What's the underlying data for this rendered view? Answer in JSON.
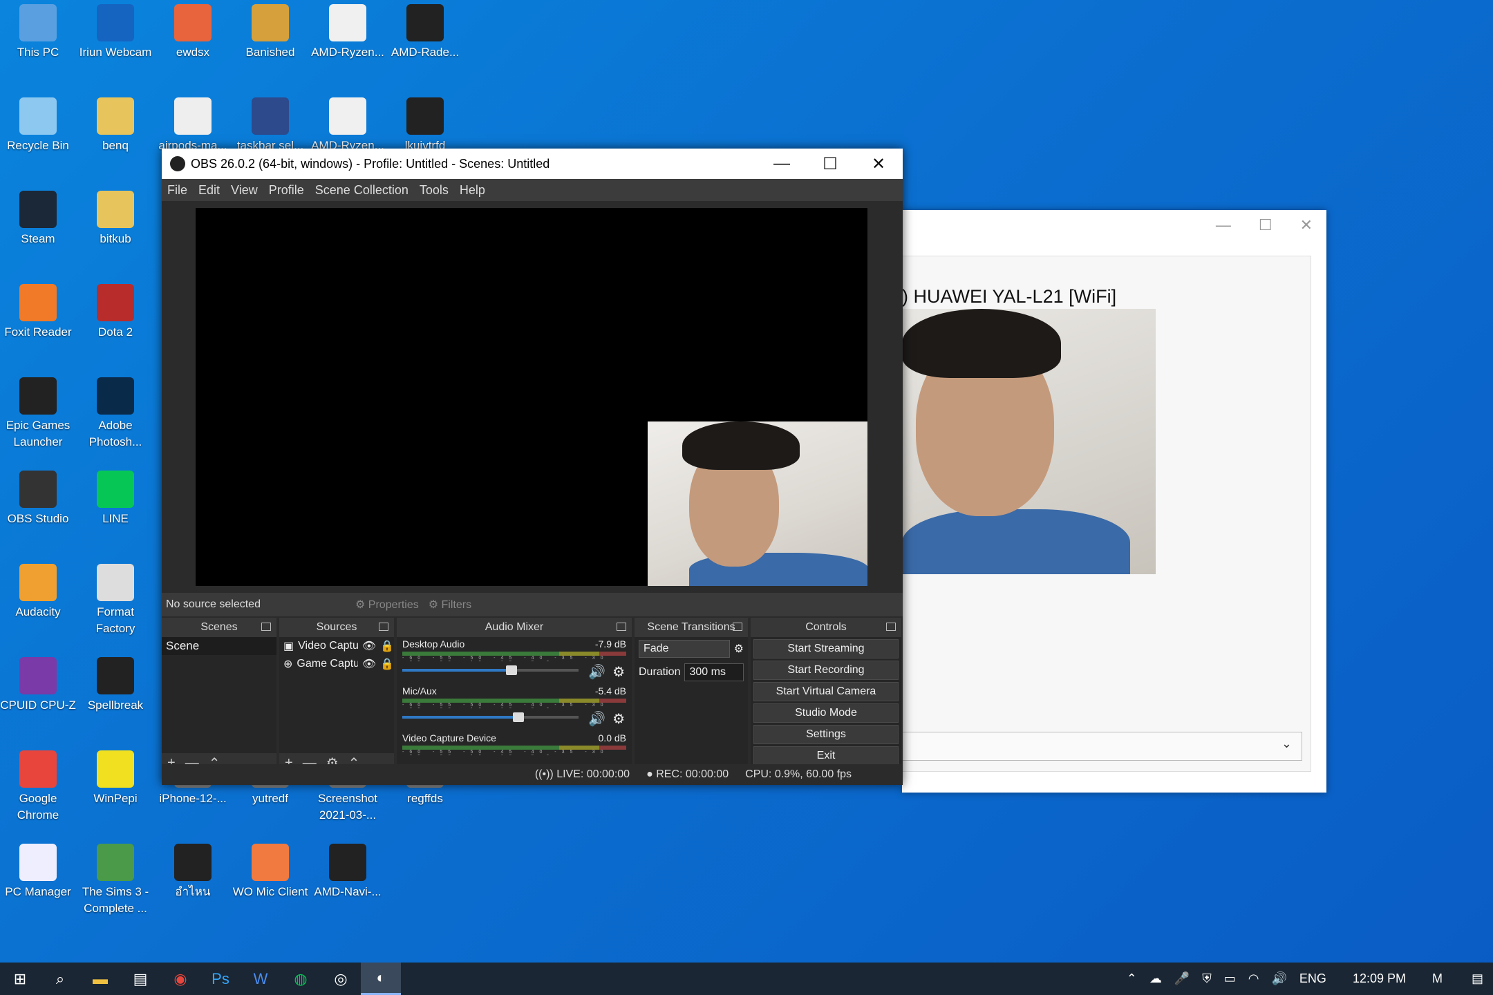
{
  "desktop": {
    "icons": [
      {
        "label": "This PC",
        "icon": "this-pc-icon",
        "color": "#5aa0e0"
      },
      {
        "label": "Iriun Webcam",
        "icon": "iriun-webcam-icon",
        "color": "#1565c0"
      },
      {
        "label": "ewdsx",
        "icon": "image-file-icon",
        "color": "#e8643c"
      },
      {
        "label": "Banished",
        "icon": "banished-game-icon",
        "color": "#d6a03c"
      },
      {
        "label": "AMD-Ryzen...",
        "icon": "image-file-icon",
        "color": "#f0f0f0"
      },
      {
        "label": "AMD-Rade...",
        "icon": "image-file-icon",
        "color": "#222"
      },
      {
        "label": "Recycle Bin",
        "icon": "recycle-bin-icon",
        "color": "#8cc8f0"
      },
      {
        "label": "benq",
        "icon": "folder-icon",
        "color": "#e8c45c"
      },
      {
        "label": "airpods-ma...",
        "icon": "image-file-icon",
        "color": "#eee"
      },
      {
        "label": "taskbar sel...",
        "icon": "image-file-icon",
        "color": "#2c4a8c"
      },
      {
        "label": "AMD-Ryzen...",
        "icon": "image-file-icon",
        "color": "#f0f0f0"
      },
      {
        "label": "lkuiytrfd",
        "icon": "image-file-icon",
        "color": "#222"
      },
      {
        "label": "Steam",
        "icon": "steam-icon",
        "color": "#1b2838"
      },
      {
        "label": "bitkub",
        "icon": "folder-icon",
        "color": "#e8c45c"
      },
      {
        "label": "Foxit Reader",
        "icon": "foxit-reader-icon",
        "color": "#f07a28"
      },
      {
        "label": "Dota 2",
        "icon": "dota2-icon",
        "color": "#b82c2c"
      },
      {
        "label": "Epic Games Launcher",
        "icon": "epic-games-icon",
        "color": "#222"
      },
      {
        "label": "Adobe Photosh...",
        "icon": "photoshop-icon",
        "color": "#0a2a4a"
      },
      {
        "label": "OBS Studio",
        "icon": "obs-icon",
        "color": "#333"
      },
      {
        "label": "LINE",
        "icon": "line-icon",
        "color": "#06c755"
      },
      {
        "label": "Audacity",
        "icon": "audacity-icon",
        "color": "#f0a030"
      },
      {
        "label": "Format Factory",
        "icon": "format-factory-icon",
        "color": "#ddd"
      },
      {
        "label": "CPUID CPU-Z",
        "icon": "cpuz-icon",
        "color": "#7a3aa8"
      },
      {
        "label": "Spellbreak",
        "icon": "spellbreak-icon",
        "color": "#222"
      },
      {
        "label": "Google Chrome",
        "icon": "chrome-icon",
        "color": "#e8453c"
      },
      {
        "label": "WinPepi",
        "icon": "winpepi-icon",
        "color": "#f0e020"
      },
      {
        "label": "iPhone-12-...",
        "icon": "image-file-icon",
        "color": "#888"
      },
      {
        "label": "yutredf",
        "icon": "image-file-icon",
        "color": "#888"
      },
      {
        "label": "Screenshot 2021-03-...",
        "icon": "image-file-icon",
        "color": "#888"
      },
      {
        "label": "regffds",
        "icon": "image-file-icon",
        "color": "#888"
      },
      {
        "label": "PC Manager",
        "icon": "pc-manager-icon",
        "color": "#eef"
      },
      {
        "label": "The Sims 3 - Complete ...",
        "icon": "sims3-icon",
        "color": "#4a9a4a"
      },
      {
        "label": "อำไหน",
        "icon": "image-file-icon",
        "color": "#222"
      },
      {
        "label": "WO Mic Client",
        "icon": "wo-mic-icon",
        "color": "#f07a40"
      },
      {
        "label": "AMD-Navi-...",
        "icon": "image-file-icon",
        "color": "#222"
      }
    ]
  },
  "camwin": {
    "title": "HUAWEI YAL-L21 [WiFi]",
    "title_prefix": ")",
    "min": "—",
    "max": "☐",
    "close": "✕",
    "dropdown_arrow": "⌄"
  },
  "obs": {
    "title": "OBS 26.0.2 (64-bit, windows) - Profile: Untitled - Scenes: Untitled",
    "menu": [
      "File",
      "Edit",
      "View",
      "Profile",
      "Scene Collection",
      "Tools",
      "Help"
    ],
    "no_source": "No source selected",
    "properties": "Properties",
    "filters": "Filters",
    "scenes_header": "Scenes",
    "scenes": [
      "Scene"
    ],
    "sources_header": "Sources",
    "sources": [
      "Video Captu",
      "Game Captu"
    ],
    "mixer_header": "Audio Mixer",
    "channels": [
      {
        "name": "Desktop Audio",
        "db": "-7.9 dB",
        "level": 0.62
      },
      {
        "name": "Mic/Aux",
        "db": "-5.4 dB",
        "level": 0.66
      },
      {
        "name": "Video Capture Device",
        "db": "0.0 dB",
        "level": 1.0
      }
    ],
    "ticks": "-60 -55 -50 -45 -40 -35 -30 -25 -20 -15 -10 -5 0",
    "transitions_header": "Scene Transitions",
    "transition": "Fade",
    "duration_label": "Duration",
    "duration": "300 ms",
    "controls_header": "Controls",
    "controls": [
      "Start Streaming",
      "Start Recording",
      "Start Virtual Camera",
      "Studio Mode",
      "Settings",
      "Exit"
    ],
    "live": "LIVE: 00:00:00",
    "rec": "REC: 00:00:00",
    "cpu": "CPU: 0.9%, 60.00 fps"
  },
  "taskbar": {
    "time": "12:09 PM",
    "lang": "ENG"
  }
}
